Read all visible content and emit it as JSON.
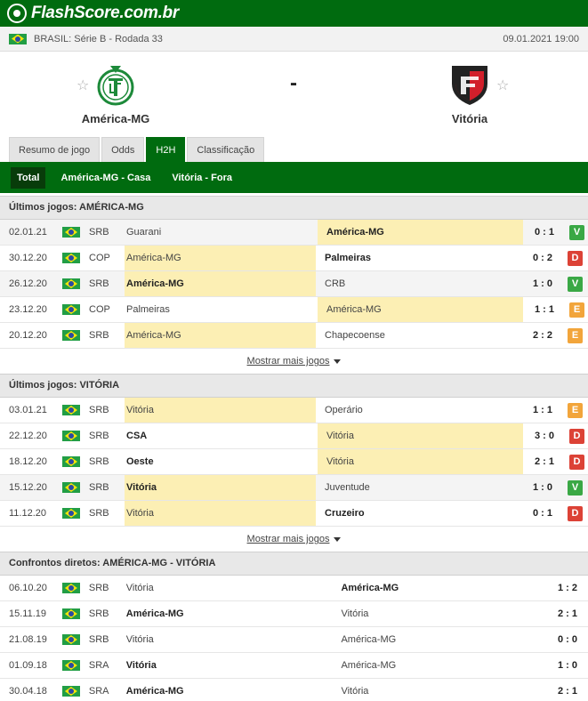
{
  "brand": {
    "name": "FlashScore.com.br"
  },
  "info": {
    "competition": "BRASIL: Série B - Rodada 33",
    "datetime": "09.01.2021 19:00"
  },
  "match": {
    "home": {
      "name": "América-MG"
    },
    "away": {
      "name": "Vitória"
    },
    "score": "-"
  },
  "tabs": [
    {
      "label": "Resumo de jogo"
    },
    {
      "label": "Odds"
    },
    {
      "label": "H2H",
      "active": true
    },
    {
      "label": "Classificação"
    }
  ],
  "subtabs": [
    {
      "label": "Total",
      "active": true
    },
    {
      "label": "América-MG - Casa"
    },
    {
      "label": "Vitória - Fora"
    }
  ],
  "sections": {
    "home_last": {
      "title": "Últimos jogos: AMÉRICA-MG",
      "more": "Mostrar mais jogos",
      "rows": [
        {
          "date": "02.01.21",
          "comp": "SRB",
          "home": "Guarani",
          "away": "América-MG",
          "score": "0 : 1",
          "result": "V",
          "hl": "away",
          "bold": "away"
        },
        {
          "date": "30.12.20",
          "comp": "COP",
          "home": "América-MG",
          "away": "Palmeiras",
          "score": "0 : 2",
          "result": "D",
          "hl": "home",
          "bold": "away"
        },
        {
          "date": "26.12.20",
          "comp": "SRB",
          "home": "América-MG",
          "away": "CRB",
          "score": "1 : 0",
          "result": "V",
          "hl": "home",
          "bold": "home"
        },
        {
          "date": "23.12.20",
          "comp": "COP",
          "home": "Palmeiras",
          "away": "América-MG",
          "score": "1 : 1",
          "result": "E",
          "hl": "away",
          "bold": ""
        },
        {
          "date": "20.12.20",
          "comp": "SRB",
          "home": "América-MG",
          "away": "Chapecoense",
          "score": "2 : 2",
          "result": "E",
          "hl": "home",
          "bold": ""
        }
      ]
    },
    "away_last": {
      "title": "Últimos jogos: VITÓRIA",
      "more": "Mostrar mais jogos",
      "rows": [
        {
          "date": "03.01.21",
          "comp": "SRB",
          "home": "Vitória",
          "away": "Operário",
          "score": "1 : 1",
          "result": "E",
          "hl": "home",
          "bold": ""
        },
        {
          "date": "22.12.20",
          "comp": "SRB",
          "home": "CSA",
          "away": "Vitória",
          "score": "3 : 0",
          "result": "D",
          "hl": "away",
          "bold": "home"
        },
        {
          "date": "18.12.20",
          "comp": "SRB",
          "home": "Oeste",
          "away": "Vitória",
          "score": "2 : 1",
          "result": "D",
          "hl": "away",
          "bold": "home"
        },
        {
          "date": "15.12.20",
          "comp": "SRB",
          "home": "Vitória",
          "away": "Juventude",
          "score": "1 : 0",
          "result": "V",
          "hl": "home",
          "bold": "home"
        },
        {
          "date": "11.12.20",
          "comp": "SRB",
          "home": "Vitória",
          "away": "Cruzeiro",
          "score": "0 : 1",
          "result": "D",
          "hl": "home",
          "bold": "away"
        }
      ]
    },
    "h2h": {
      "title": "Confrontos diretos: AMÉRICA-MG - VITÓRIA",
      "rows": [
        {
          "date": "06.10.20",
          "comp": "SRB",
          "home": "Vitória",
          "away": "América-MG",
          "score": "1 : 2",
          "bold": "away"
        },
        {
          "date": "15.11.19",
          "comp": "SRB",
          "home": "América-MG",
          "away": "Vitória",
          "score": "2 : 1",
          "bold": "home"
        },
        {
          "date": "21.08.19",
          "comp": "SRB",
          "home": "Vitória",
          "away": "América-MG",
          "score": "0 : 0",
          "bold": ""
        },
        {
          "date": "01.09.18",
          "comp": "SRA",
          "home": "Vitória",
          "away": "América-MG",
          "score": "1 : 0",
          "bold": "home"
        },
        {
          "date": "30.04.18",
          "comp": "SRA",
          "home": "América-MG",
          "away": "Vitória",
          "score": "2 : 1",
          "bold": "home"
        }
      ]
    }
  },
  "colors": {
    "brand_green": "#006b0f",
    "highlight": "#fcefb4",
    "win": "#3aa845",
    "loss": "#dc4236",
    "draw": "#f2a53b"
  }
}
